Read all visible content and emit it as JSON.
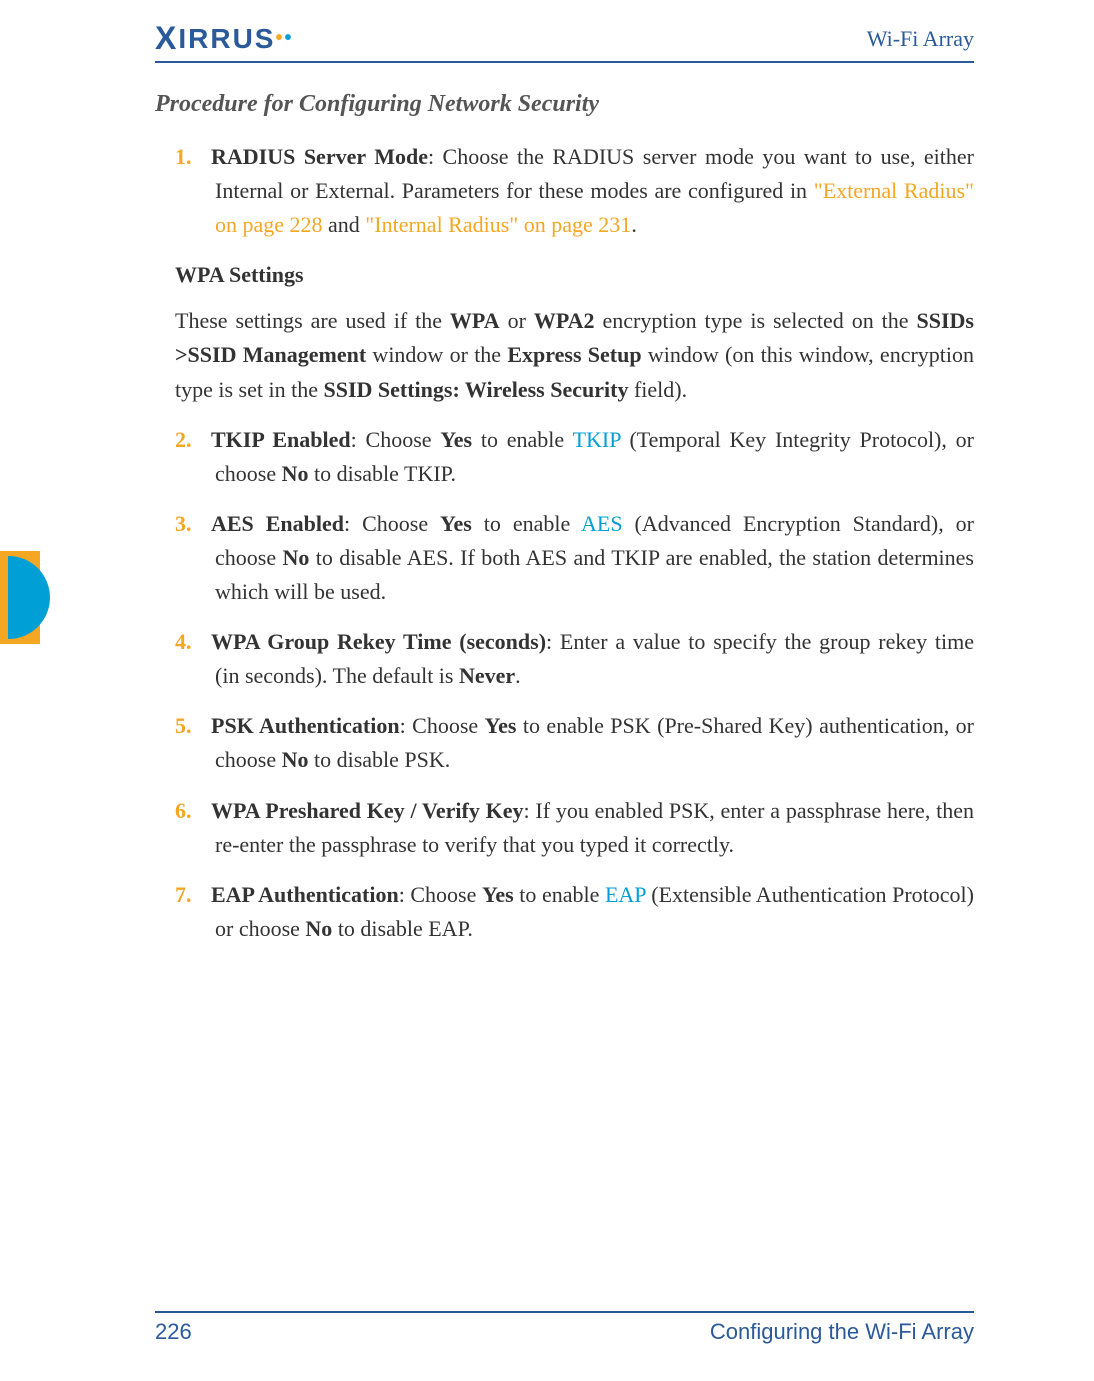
{
  "header": {
    "brand": "XIRRUS",
    "doc_title": "Wi-Fi Array"
  },
  "section": {
    "title": "Procedure for Configuring Network Security"
  },
  "items": {
    "n1": "1.",
    "n2": "2.",
    "n3": "3.",
    "n4": "4.",
    "n5": "5.",
    "n6": "6.",
    "n7": "7.",
    "label_radius": "RADIUS Server Mode",
    "txt_radius_a": ": Choose the RADIUS server mode you want to use, either Internal or External. Parameters for these modes are configured in ",
    "link_ext_radius": "\"External Radius\" on page 228",
    "txt_radius_b": " and ",
    "link_int_radius": "\"Internal Radius\" on page 231",
    "txt_radius_c": ".",
    "wpa_heading": "WPA Settings",
    "wpa_intro_a": "These settings are used if the ",
    "wpa_intro_b": "WPA",
    "wpa_intro_c": " or ",
    "wpa_intro_d": "WPA2",
    "wpa_intro_e": " encryption type is selected on the ",
    "wpa_intro_f": "SSIDs >SSID Management",
    "wpa_intro_g": " window or the ",
    "wpa_intro_h": "Express Setup",
    "wpa_intro_i": " window (on this window, encryption type is set in the ",
    "wpa_intro_j": "SSID Settings: Wireless Security",
    "wpa_intro_k": " field).",
    "label_tkip": "TKIP Enabled",
    "txt_tkip_a": ": Choose ",
    "txt_tkip_b": "Yes",
    "txt_tkip_c": " to enable ",
    "link_tkip": "TKIP",
    "txt_tkip_d": " (Temporal Key Integrity Protocol), or choose ",
    "txt_tkip_e": "No",
    "txt_tkip_f": " to disable TKIP.",
    "label_aes": "AES Enabled",
    "txt_aes_a": ": Choose ",
    "txt_aes_b": "Yes",
    "txt_aes_c": " to enable ",
    "link_aes": "AES",
    "txt_aes_d": " (Advanced Encryption Standard), or choose ",
    "txt_aes_e": "No",
    "txt_aes_f": " to disable AES. If both AES and TKIP are enabled, the station determines which will be used.",
    "label_rekey": "WPA Group Rekey Time (seconds)",
    "txt_rekey_a": ": Enter a value to specify the group rekey time (in seconds). The default is ",
    "txt_rekey_b": "Never",
    "txt_rekey_c": ".",
    "label_psk": "PSK Authentication",
    "txt_psk_a": ": Choose ",
    "txt_psk_b": "Yes",
    "txt_psk_c": " to enable PSK (Pre-Shared Key) authentication, or choose ",
    "txt_psk_d": "No",
    "txt_psk_e": " to disable PSK.",
    "label_preshared": "WPA Preshared Key / Verify Key",
    "txt_preshared": ": If you enabled PSK, enter a passphrase here, then re-enter the passphrase to verify that you typed it correctly.",
    "label_eap": "EAP Authentication",
    "txt_eap_a": ": Choose ",
    "txt_eap_b": "Yes",
    "txt_eap_c": " to enable ",
    "link_eap": "EAP",
    "txt_eap_d": " (Extensible Authentication Protocol) or choose ",
    "txt_eap_e": "No",
    "txt_eap_f": " to disable EAP."
  },
  "footer": {
    "page_num": "226",
    "chapter": "Configuring the Wi-Fi Array"
  }
}
